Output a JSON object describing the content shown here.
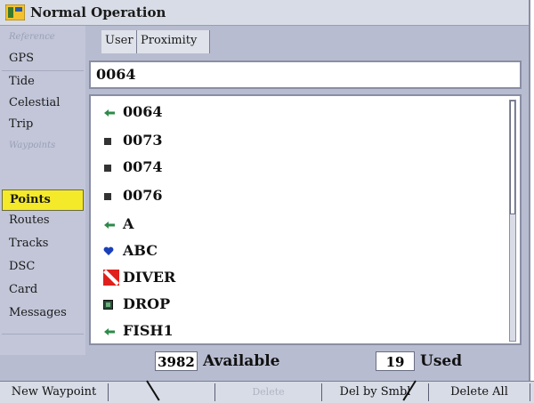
{
  "window": {
    "title": "Normal Operation"
  },
  "sidebar": {
    "items": [
      {
        "label": "Reference",
        "type": "header"
      },
      {
        "label": "GPS"
      },
      {
        "label": "Tide"
      },
      {
        "label": "Celestial"
      },
      {
        "label": "Trip"
      },
      {
        "label": "Waypoints",
        "type": "header"
      },
      {
        "label": "Points",
        "active": true
      },
      {
        "label": "Routes"
      },
      {
        "label": "Tracks"
      },
      {
        "label": "DSC"
      },
      {
        "label": "Card"
      },
      {
        "label": "Messages"
      }
    ]
  },
  "tabs": [
    {
      "label": "User"
    },
    {
      "label": "Proximity"
    }
  ],
  "search": {
    "value": "0064"
  },
  "waypoints": [
    {
      "name": "0064",
      "icon": "arrow-icon"
    },
    {
      "name": "0073",
      "icon": "square-icon"
    },
    {
      "name": "0074",
      "icon": "square-icon"
    },
    {
      "name": "0076",
      "icon": "square-icon"
    },
    {
      "name": "A",
      "icon": "arrow-icon"
    },
    {
      "name": "ABC",
      "icon": "heart-icon"
    },
    {
      "name": "DIVER",
      "icon": "diver-flag-icon"
    },
    {
      "name": "DROP",
      "icon": "drop-icon"
    },
    {
      "name": "FISH1",
      "icon": "arrow-icon"
    }
  ],
  "status": {
    "available_count": "3982",
    "available_label": "Available",
    "used_count": "19",
    "used_label": "Used"
  },
  "softkeys": [
    {
      "label": "New Waypoint",
      "enabled": true
    },
    {
      "label": "",
      "enabled": true
    },
    {
      "label": "Delete",
      "enabled": false
    },
    {
      "label": "Del by Smbl",
      "enabled": true
    },
    {
      "label": "Delete All",
      "enabled": true
    }
  ],
  "colors": {
    "accent": "#f4ea2a",
    "background": "#b8bcd0",
    "diver_flag": "#e0201c"
  }
}
